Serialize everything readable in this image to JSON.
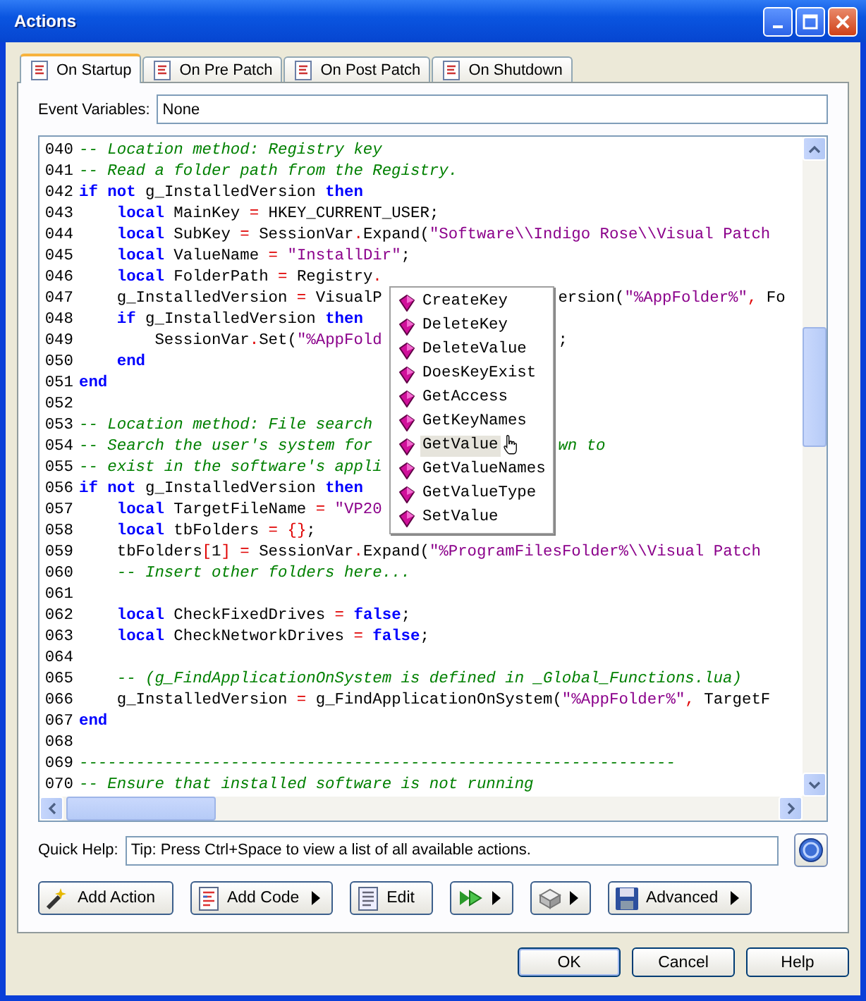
{
  "window": {
    "title": "Actions"
  },
  "tabs": [
    {
      "label": "On Startup",
      "selected": true
    },
    {
      "label": "On Pre Patch",
      "selected": false
    },
    {
      "label": "On Post Patch",
      "selected": false
    },
    {
      "label": "On Shutdown",
      "selected": false
    }
  ],
  "event_variables": {
    "label": "Event Variables:",
    "value": "None"
  },
  "editor": {
    "lines": [
      {
        "num": "040",
        "tokens": [
          {
            "kind": "comment",
            "t": "-- Location method: Registry key"
          }
        ]
      },
      {
        "num": "041",
        "tokens": [
          {
            "kind": "comment",
            "t": "-- Read a folder path from the Registry."
          }
        ]
      },
      {
        "num": "042",
        "tokens": [
          {
            "kind": "keyword",
            "t": "if"
          },
          {
            "kind": "keyword",
            "t": " not"
          },
          {
            "kind": "name",
            "t": " g_InstalledVersion "
          },
          {
            "kind": "keyword",
            "t": "then"
          }
        ]
      },
      {
        "num": "043",
        "tokens": [
          {
            "kind": "keyword",
            "t": "    local"
          },
          {
            "kind": "name",
            "t": " MainKey "
          },
          {
            "kind": "operator",
            "t": "="
          },
          {
            "kind": "name",
            "t": " HKEY_CURRENT_USER;"
          }
        ]
      },
      {
        "num": "044",
        "tokens": [
          {
            "kind": "keyword",
            "t": "    local"
          },
          {
            "kind": "name",
            "t": " SubKey "
          },
          {
            "kind": "operator",
            "t": "="
          },
          {
            "kind": "name",
            "t": " SessionVar"
          },
          {
            "kind": "operator",
            "t": "."
          },
          {
            "kind": "name",
            "t": "Expand("
          },
          {
            "kind": "string",
            "t": "\"Software\\\\Indigo Rose\\\\Visual Patch"
          }
        ]
      },
      {
        "num": "045",
        "tokens": [
          {
            "kind": "keyword",
            "t": "    local"
          },
          {
            "kind": "name",
            "t": " ValueName "
          },
          {
            "kind": "operator",
            "t": "="
          },
          {
            "kind": "string",
            "t": " \"InstallDir\""
          },
          {
            "kind": "name",
            "t": ";"
          }
        ]
      },
      {
        "num": "046",
        "tokens": [
          {
            "kind": "keyword",
            "t": "    local"
          },
          {
            "kind": "name",
            "t": " FolderPath "
          },
          {
            "kind": "operator",
            "t": "="
          },
          {
            "kind": "name",
            "t": " Registry"
          },
          {
            "kind": "operator",
            "t": "."
          }
        ]
      },
      {
        "num": "047",
        "tokens": [
          {
            "kind": "name",
            "t": "    g_InstalledVersion "
          },
          {
            "kind": "operator",
            "t": "="
          },
          {
            "kind": "name",
            "t": " VisualP"
          }
        ],
        "after": [
          {
            "kind": "name",
            "t": "ersion("
          },
          {
            "kind": "string",
            "t": "\"%AppFolder%\""
          },
          {
            "kind": "operator",
            "t": ","
          },
          {
            "kind": "name",
            "t": " Fo"
          }
        ]
      },
      {
        "num": "048",
        "tokens": [
          {
            "kind": "keyword",
            "t": "    if"
          },
          {
            "kind": "name",
            "t": " g_InstalledVersion "
          },
          {
            "kind": "keyword",
            "t": "then"
          }
        ]
      },
      {
        "num": "049",
        "tokens": [
          {
            "kind": "name",
            "t": "        SessionVar"
          },
          {
            "kind": "operator",
            "t": "."
          },
          {
            "kind": "name",
            "t": "Set("
          },
          {
            "kind": "string",
            "t": "\"%AppFold"
          }
        ],
        "after": [
          {
            "kind": "name",
            "t": ";"
          }
        ]
      },
      {
        "num": "050",
        "tokens": [
          {
            "kind": "keyword",
            "t": "    end"
          }
        ]
      },
      {
        "num": "051",
        "tokens": [
          {
            "kind": "keyword",
            "t": "end"
          }
        ]
      },
      {
        "num": "052"
      },
      {
        "num": "053",
        "tokens": [
          {
            "kind": "comment",
            "t": "-- Location method: File search"
          }
        ]
      },
      {
        "num": "054",
        "tokens": [
          {
            "kind": "comment",
            "t": "-- Search the user's system for"
          }
        ],
        "after": [
          {
            "kind": "comment",
            "t": "wn to"
          }
        ]
      },
      {
        "num": "055",
        "tokens": [
          {
            "kind": "comment",
            "t": "-- exist in the software's appli"
          }
        ]
      },
      {
        "num": "056",
        "tokens": [
          {
            "kind": "keyword",
            "t": "if"
          },
          {
            "kind": "keyword",
            "t": " not"
          },
          {
            "kind": "name",
            "t": " g_InstalledVersion "
          },
          {
            "kind": "keyword",
            "t": "then"
          }
        ]
      },
      {
        "num": "057",
        "tokens": [
          {
            "kind": "keyword",
            "t": "    local"
          },
          {
            "kind": "name",
            "t": " TargetFileName "
          },
          {
            "kind": "operator",
            "t": "="
          },
          {
            "kind": "string",
            "t": " \"VP20"
          }
        ]
      },
      {
        "num": "058",
        "tokens": [
          {
            "kind": "keyword",
            "t": "    local"
          },
          {
            "kind": "name",
            "t": " tbFolders "
          },
          {
            "kind": "operator",
            "t": "="
          },
          {
            "kind": "operator",
            "t": " {}"
          },
          {
            "kind": "name",
            "t": ";"
          }
        ]
      },
      {
        "num": "059",
        "tokens": [
          {
            "kind": "name",
            "t": "    tbFolders"
          },
          {
            "kind": "operator",
            "t": "["
          },
          {
            "kind": "name",
            "t": "1"
          },
          {
            "kind": "operator",
            "t": "] ="
          },
          {
            "kind": "name",
            "t": " SessionVar"
          },
          {
            "kind": "operator",
            "t": "."
          },
          {
            "kind": "name",
            "t": "Expand("
          },
          {
            "kind": "string",
            "t": "\"%ProgramFilesFolder%\\\\Visual Patch"
          }
        ]
      },
      {
        "num": "060",
        "tokens": [
          {
            "kind": "comment",
            "t": "    -- Insert other folders here..."
          }
        ]
      },
      {
        "num": "061"
      },
      {
        "num": "062",
        "tokens": [
          {
            "kind": "keyword",
            "t": "    local"
          },
          {
            "kind": "name",
            "t": " CheckFixedDrives "
          },
          {
            "kind": "operator",
            "t": "="
          },
          {
            "kind": "keyword",
            "t": " false"
          },
          {
            "kind": "name",
            "t": ";"
          }
        ]
      },
      {
        "num": "063",
        "tokens": [
          {
            "kind": "keyword",
            "t": "    local"
          },
          {
            "kind": "name",
            "t": " CheckNetworkDrives "
          },
          {
            "kind": "operator",
            "t": "="
          },
          {
            "kind": "keyword",
            "t": " false"
          },
          {
            "kind": "name",
            "t": ";"
          }
        ]
      },
      {
        "num": "064"
      },
      {
        "num": "065",
        "tokens": [
          {
            "kind": "comment",
            "t": "    -- (g_FindApplicationOnSystem is defined in _Global_Functions.lua)"
          }
        ]
      },
      {
        "num": "066",
        "tokens": [
          {
            "kind": "name",
            "t": "    g_InstalledVersion "
          },
          {
            "kind": "operator",
            "t": "="
          },
          {
            "kind": "name",
            "t": " g_FindApplicationOnSystem("
          },
          {
            "kind": "string",
            "t": "\"%AppFolder%\""
          },
          {
            "kind": "operator",
            "t": ","
          },
          {
            "kind": "name",
            "t": " TargetF"
          }
        ]
      },
      {
        "num": "067",
        "tokens": [
          {
            "kind": "keyword",
            "t": "end"
          }
        ]
      },
      {
        "num": "068"
      },
      {
        "num": "069",
        "tokens": [
          {
            "kind": "comment",
            "t": "---------------------------------------------------------------"
          }
        ]
      },
      {
        "num": "070",
        "tokens": [
          {
            "kind": "comment",
            "t": "-- Ensure that installed software is not running"
          }
        ]
      }
    ],
    "completion": [
      {
        "label": "CreateKey",
        "selected": false
      },
      {
        "label": "DeleteKey",
        "selected": false
      },
      {
        "label": "DeleteValue",
        "selected": false
      },
      {
        "label": "DoesKeyExist",
        "selected": false
      },
      {
        "label": "GetAccess",
        "selected": false
      },
      {
        "label": "GetKeyNames",
        "selected": false
      },
      {
        "label": "GetValue",
        "selected": true
      },
      {
        "label": "GetValueNames",
        "selected": false
      },
      {
        "label": "GetValueType",
        "selected": false
      },
      {
        "label": "SetValue",
        "selected": false
      }
    ]
  },
  "quick_help": {
    "label": "Quick Help:",
    "value": "Tip: Press Ctrl+Space to view a list of all available actions."
  },
  "toolbar": [
    {
      "kind": "action",
      "label": "Add Action",
      "menu": false
    },
    {
      "kind": "code",
      "label": "Add Code",
      "menu": true
    },
    {
      "kind": "edit",
      "label": "Edit",
      "menu": false
    },
    {
      "kind": "arrows",
      "menu": true
    },
    {
      "kind": "box",
      "menu": true
    },
    {
      "kind": "disk",
      "label": "Advanced",
      "menu": true
    }
  ],
  "buttons": [
    {
      "label": "OK",
      "default": true
    },
    {
      "label": "Cancel",
      "default": false
    },
    {
      "label": "Help",
      "default": false
    }
  ]
}
